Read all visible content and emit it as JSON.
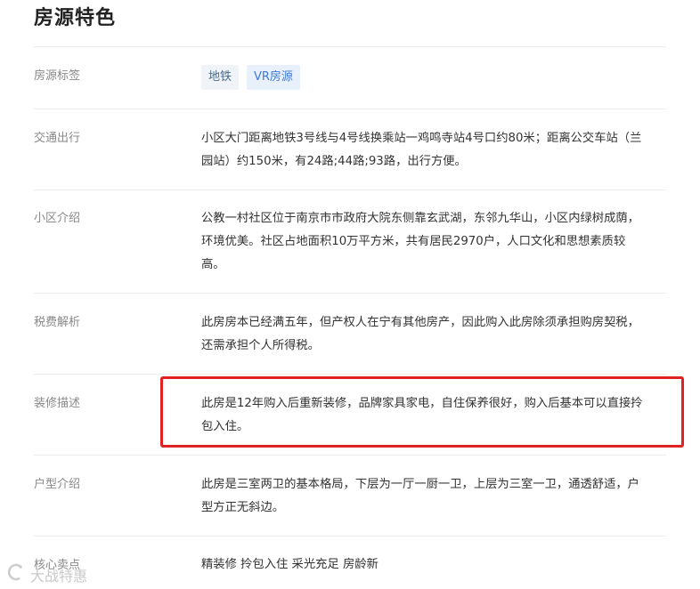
{
  "section": {
    "title": "房源特色"
  },
  "tags": {
    "label": "房源标签",
    "items": [
      "地铁",
      "VR房源"
    ]
  },
  "rows": [
    {
      "label": "交通出行",
      "lines": [
        "小区大门距离地铁3号线与4号线换乘站一鸡鸣寺站4号口约80米；距离公交车站（兰",
        "园站）约150米，有24路;44路;93路，出行方便。"
      ]
    },
    {
      "label": "小区介绍",
      "lines": [
        "公教一村社区位于南京市市政府大院东侧靠玄武湖，东邻九华山，小区内绿树成荫，",
        "环境优美。社区占地面积10万平方米，共有居民2970户，人口文化和思想素质较",
        "高。"
      ]
    },
    {
      "label": "税费解析",
      "lines": [
        "此房房本已经满五年，但产权人在宁有其他房产，因此购入此房除须承担购房契税，",
        "还需承担个人所得税。"
      ]
    },
    {
      "label": "装修描述",
      "lines": [
        "此房是12年购入后重新装修，品牌家具家电，自住保养很好，购入后基本可以直接拎",
        "包入住。"
      ]
    },
    {
      "label": "户型介绍",
      "lines": [
        "此房是三室两卫的基本格局，下层为一厅一厨一卫，上层为三室一卫，通透舒适，户",
        "型方正无斜边。"
      ]
    },
    {
      "label": "核心卖点",
      "lines": [
        "精装修 拎包入住 采光充足 房龄新"
      ]
    }
  ],
  "watermark": {
    "text": "大战特惠"
  },
  "colors": {
    "highlight_border": "#e02222",
    "tag_vr_bg": "#e8f0fc",
    "tag_vr_text": "#3f7ad6"
  }
}
